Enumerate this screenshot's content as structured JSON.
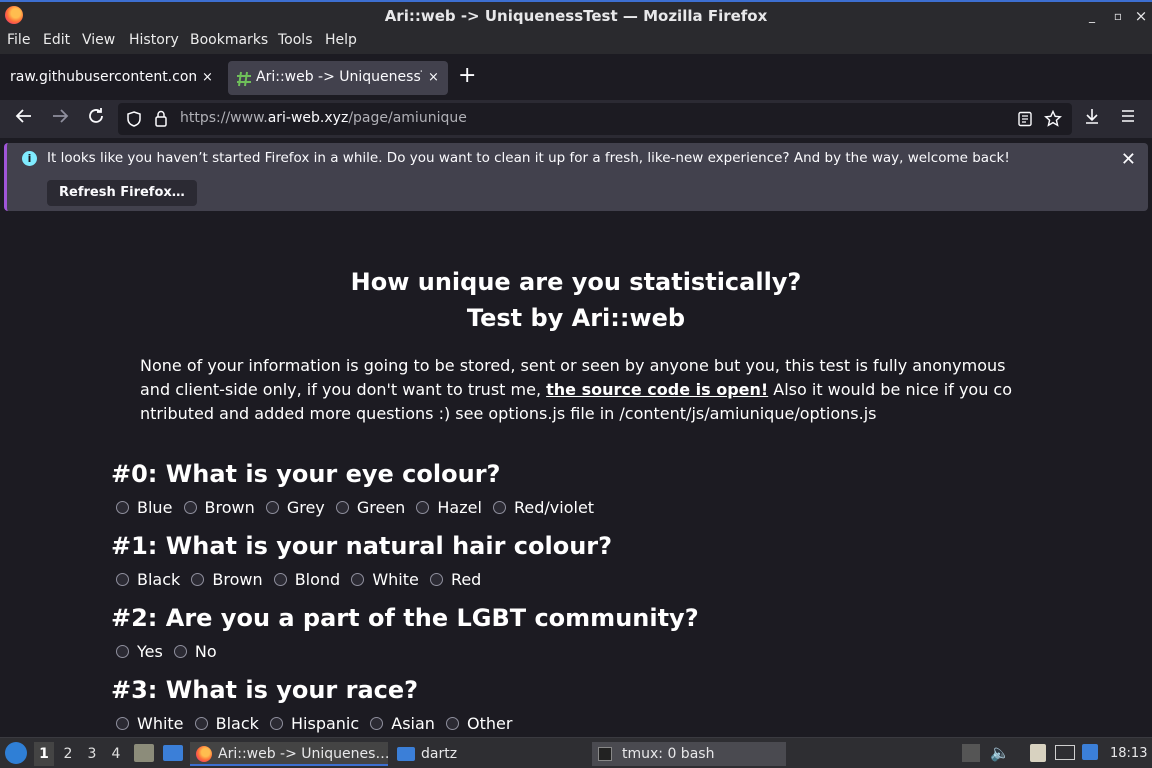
{
  "window": {
    "title": "Ari::web -> UniquenessTest — Mozilla Firefox",
    "controls": [
      "_",
      "▫",
      "×"
    ]
  },
  "menu": [
    "File",
    "Edit",
    "View",
    "History",
    "Bookmarks",
    "Tools",
    "Help"
  ],
  "tabs": [
    {
      "label": "raw.githubusercontent.com/i",
      "close": "×"
    },
    {
      "label": "Ari::web -> UniquenessTe",
      "close": "×"
    }
  ],
  "new_tab": "+",
  "navigation": {
    "url_prefix": "https://www.",
    "url_host": "ari-web.xyz",
    "url_path": "/page/amiunique"
  },
  "notification": {
    "message": "It looks like you haven’t started Firefox in a while. Do you want to clean it up for a fresh, like-new experience? And by the way, welcome back!",
    "button": "Refresh Firefox…"
  },
  "page": {
    "title_line1": "How unique are you statistically?",
    "title_line2": "Test by Ari::web",
    "intro_before_link": "None of your information is going to be stored, sent or seen by anyone but you, this test is fully anonymous and client-side only, if you don't want to trust me, ",
    "intro_link": "the source code is open!",
    "intro_after_link": " Also it would be nice if you co ntributed and added more questions :) see options.js file in /content/js/amiunique/options.js",
    "questions": [
      {
        "title": "#0: What is your eye colour?",
        "options": [
          "Blue",
          "Brown",
          "Grey",
          "Green",
          "Hazel",
          "Red/violet"
        ]
      },
      {
        "title": "#1: What is your natural hair colour?",
        "options": [
          "Black",
          "Brown",
          "Blond",
          "White",
          "Red"
        ]
      },
      {
        "title": "#2: Are you a part of the LGBT community?",
        "options": [
          "Yes",
          "No"
        ]
      },
      {
        "title": "#3: What is your race?",
        "options": [
          "White",
          "Black",
          "Hispanic",
          "Asian",
          "Other"
        ]
      }
    ]
  },
  "taskbar": {
    "workspaces": [
      "1",
      "2",
      "3",
      "4"
    ],
    "apps": [
      {
        "label": "Ari::web -> Uniquenes…"
      },
      {
        "label": "dartz"
      },
      {
        "label": "tmux: 0 bash"
      }
    ],
    "clock": "18:13"
  }
}
